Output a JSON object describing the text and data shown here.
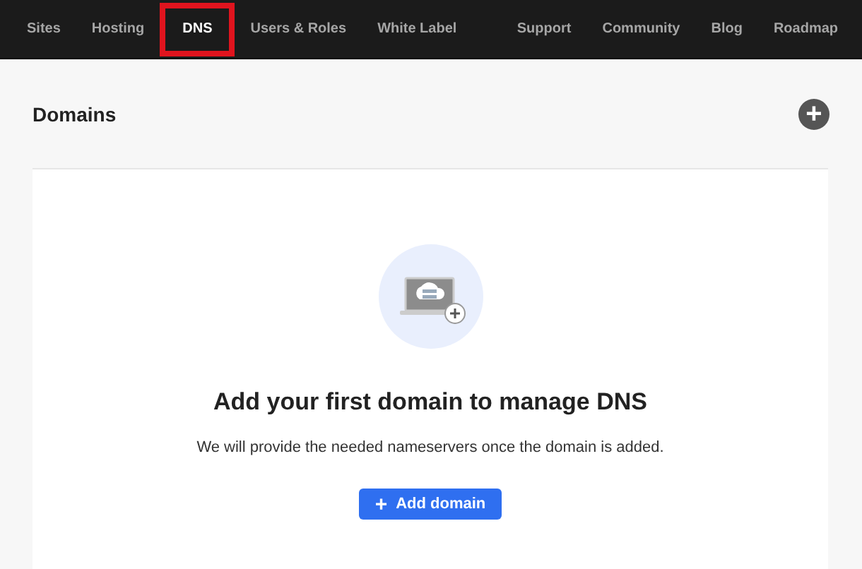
{
  "nav": {
    "left": [
      {
        "label": "Sites",
        "selected": false,
        "highlighted": false
      },
      {
        "label": "Hosting",
        "selected": false,
        "highlighted": false
      },
      {
        "label": "DNS",
        "selected": true,
        "highlighted": true
      },
      {
        "label": "Users & Roles",
        "selected": false,
        "highlighted": false
      },
      {
        "label": "White Label",
        "selected": false,
        "highlighted": false
      }
    ],
    "right": [
      {
        "label": "Support"
      },
      {
        "label": "Community"
      },
      {
        "label": "Blog"
      },
      {
        "label": "Roadmap"
      }
    ]
  },
  "section": {
    "title": "Domains",
    "add_icon": "+"
  },
  "empty_state": {
    "heading": "Add your first domain to manage DNS",
    "message": "We will provide the needed nameservers once the domain is added.",
    "button": {
      "icon": "+",
      "label": "Add domain"
    }
  }
}
